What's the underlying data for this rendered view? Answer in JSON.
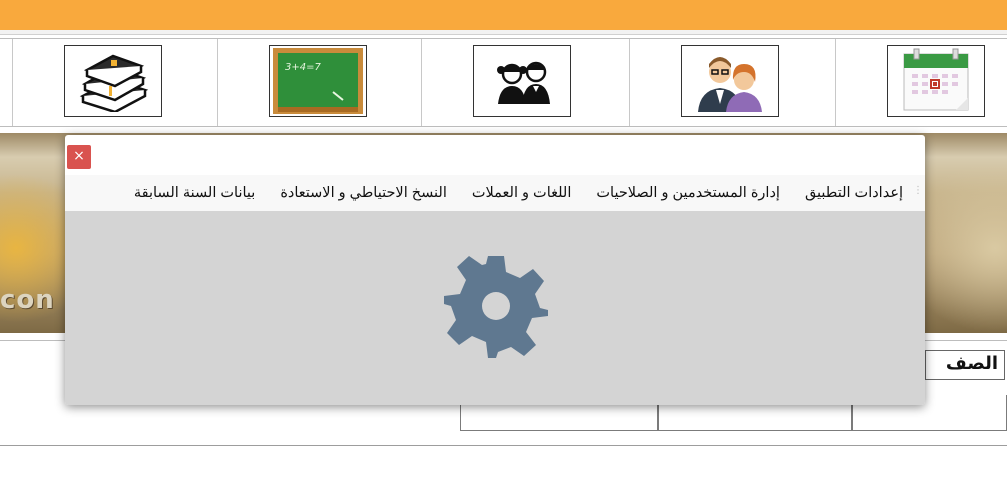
{
  "toolbar": {
    "tiles": [
      {
        "icon": "books-icon"
      },
      {
        "icon": "chalkboard-icon",
        "chalk_text": "3+4=7"
      },
      {
        "icon": "students-icon"
      },
      {
        "icon": "teachers-icon"
      },
      {
        "icon": "calendar-icon"
      }
    ]
  },
  "banner": {
    "word": "con"
  },
  "table": {
    "header": "الصف"
  },
  "dialog": {
    "close_label": "×",
    "menu": [
      "إعدادات التطبيق",
      "إدارة المستخدمين و الصلاحيات",
      "اللغات و العملات",
      "النسخ الاحتياطي و الاستعادة",
      "بيانات السنة السابقة"
    ],
    "body_icon": "gear-icon",
    "gear_color": "#5f7890"
  },
  "colors": {
    "accent": "#f9a93d",
    "close": "#d9534f",
    "dialog_body": "#d4d4d4"
  }
}
